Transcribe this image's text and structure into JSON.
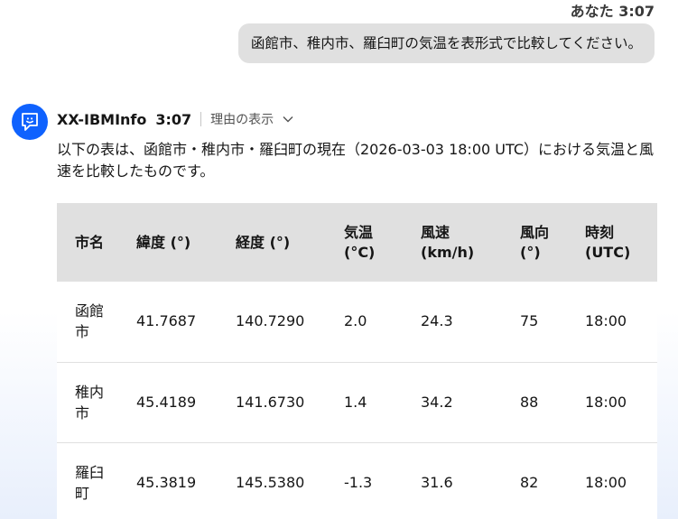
{
  "user": {
    "sender": "あなた",
    "time": "3:07",
    "message": "函館市、稚内市、羅臼町の気温を表形式で比較してください。"
  },
  "bot": {
    "name": "XX-IBMInfo",
    "time": "3:07",
    "reason_label": "理由の表示",
    "avatar_icon": "chat-bot-icon",
    "intro": "以下の表は、函館市・稚内市・羅臼町の現在（2026-03-03 18:00 UTC）における気温と風速を比較したものです。",
    "table": {
      "headers": [
        "市名",
        "緯度 (°)",
        "経度 (°)",
        "気温 (°C)",
        "風速 (km/h)",
        "風向 (°)",
        "時刻 (UTC)"
      ],
      "rows": [
        [
          "函館市",
          "41.7687",
          "140.7290",
          "2.0",
          "24.3",
          "75",
          "18:00"
        ],
        [
          "稚内市",
          "45.4189",
          "141.6730",
          "1.4",
          "34.2",
          "88",
          "18:00"
        ],
        [
          "羅臼町",
          "45.3819",
          "145.5380",
          "-1.3",
          "31.6",
          "82",
          "18:00"
        ]
      ]
    }
  },
  "colors": {
    "accent": "#0f62fe",
    "bubble": "#e0e0e0",
    "table_header": "#e0e0e0"
  }
}
